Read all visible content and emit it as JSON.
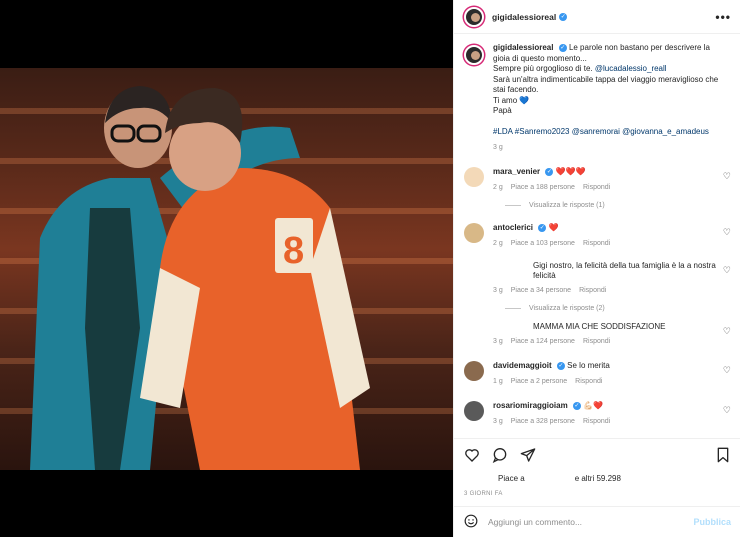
{
  "post": {
    "username": "gigidalessioreal",
    "more_label": "•••"
  },
  "caption": {
    "username": "gigidalessioreal",
    "line1": "Le parole non bastano per descrivere la gioia di questo momento...",
    "line2_prefix": "Sempre più orgoglioso di te. ",
    "line2_mention": "@lucadalessio_reall",
    "line3": "Sarà un'altra indimenticabile tappa del viaggio meraviglioso che stai facendo.",
    "line4": "Ti amo 💙",
    "line5": "Papà",
    "tags": "#LDA #Sanremo2023 @sanremorai @giovanna_e_amadeus",
    "time": "3 g"
  },
  "comments": [
    {
      "username": "mara_venier",
      "text": "❤️❤️❤️",
      "time": "2 g",
      "likes": "Piace a 188 persone",
      "reply": "Rispondi"
    },
    {
      "username": "antoclerici",
      "text": "❤️",
      "time": "2 g",
      "likes": "Piace a 103 persone",
      "reply": "Rispondi"
    },
    {
      "username": "",
      "text": "Gigi nostro, la felicità della tua famiglia è la a nostra felicità",
      "time": "3 g",
      "likes": "Piace a 34 persone",
      "reply": "Rispondi"
    },
    {
      "username": "",
      "text": "MAMMA MIA CHE SODDISFAZIONE",
      "time": "3 g",
      "likes": "Piace a 124 persone",
      "reply": "Rispondi"
    },
    {
      "username": "davidemaggioit",
      "text": "Se lo merita",
      "time": "1 g",
      "likes": "Piace a 2 persone",
      "reply": "Rispondi"
    },
    {
      "username": "rosariomiraggioiam",
      "text": "💪🏻❤️",
      "time": "3 g",
      "likes": "Piace a 328 persone",
      "reply": "Rispondi"
    }
  ],
  "replies": [
    "Visualizza le risposte (1)",
    "Visualizza le risposte (2)"
  ],
  "actions": {
    "likes_prefix": "Piace a",
    "likes_suffix": "e altri 59.298",
    "date": "3 GIORNI FA"
  },
  "add_comment": {
    "placeholder": "Aggiungi un commento...",
    "publish": "Pubblica"
  }
}
